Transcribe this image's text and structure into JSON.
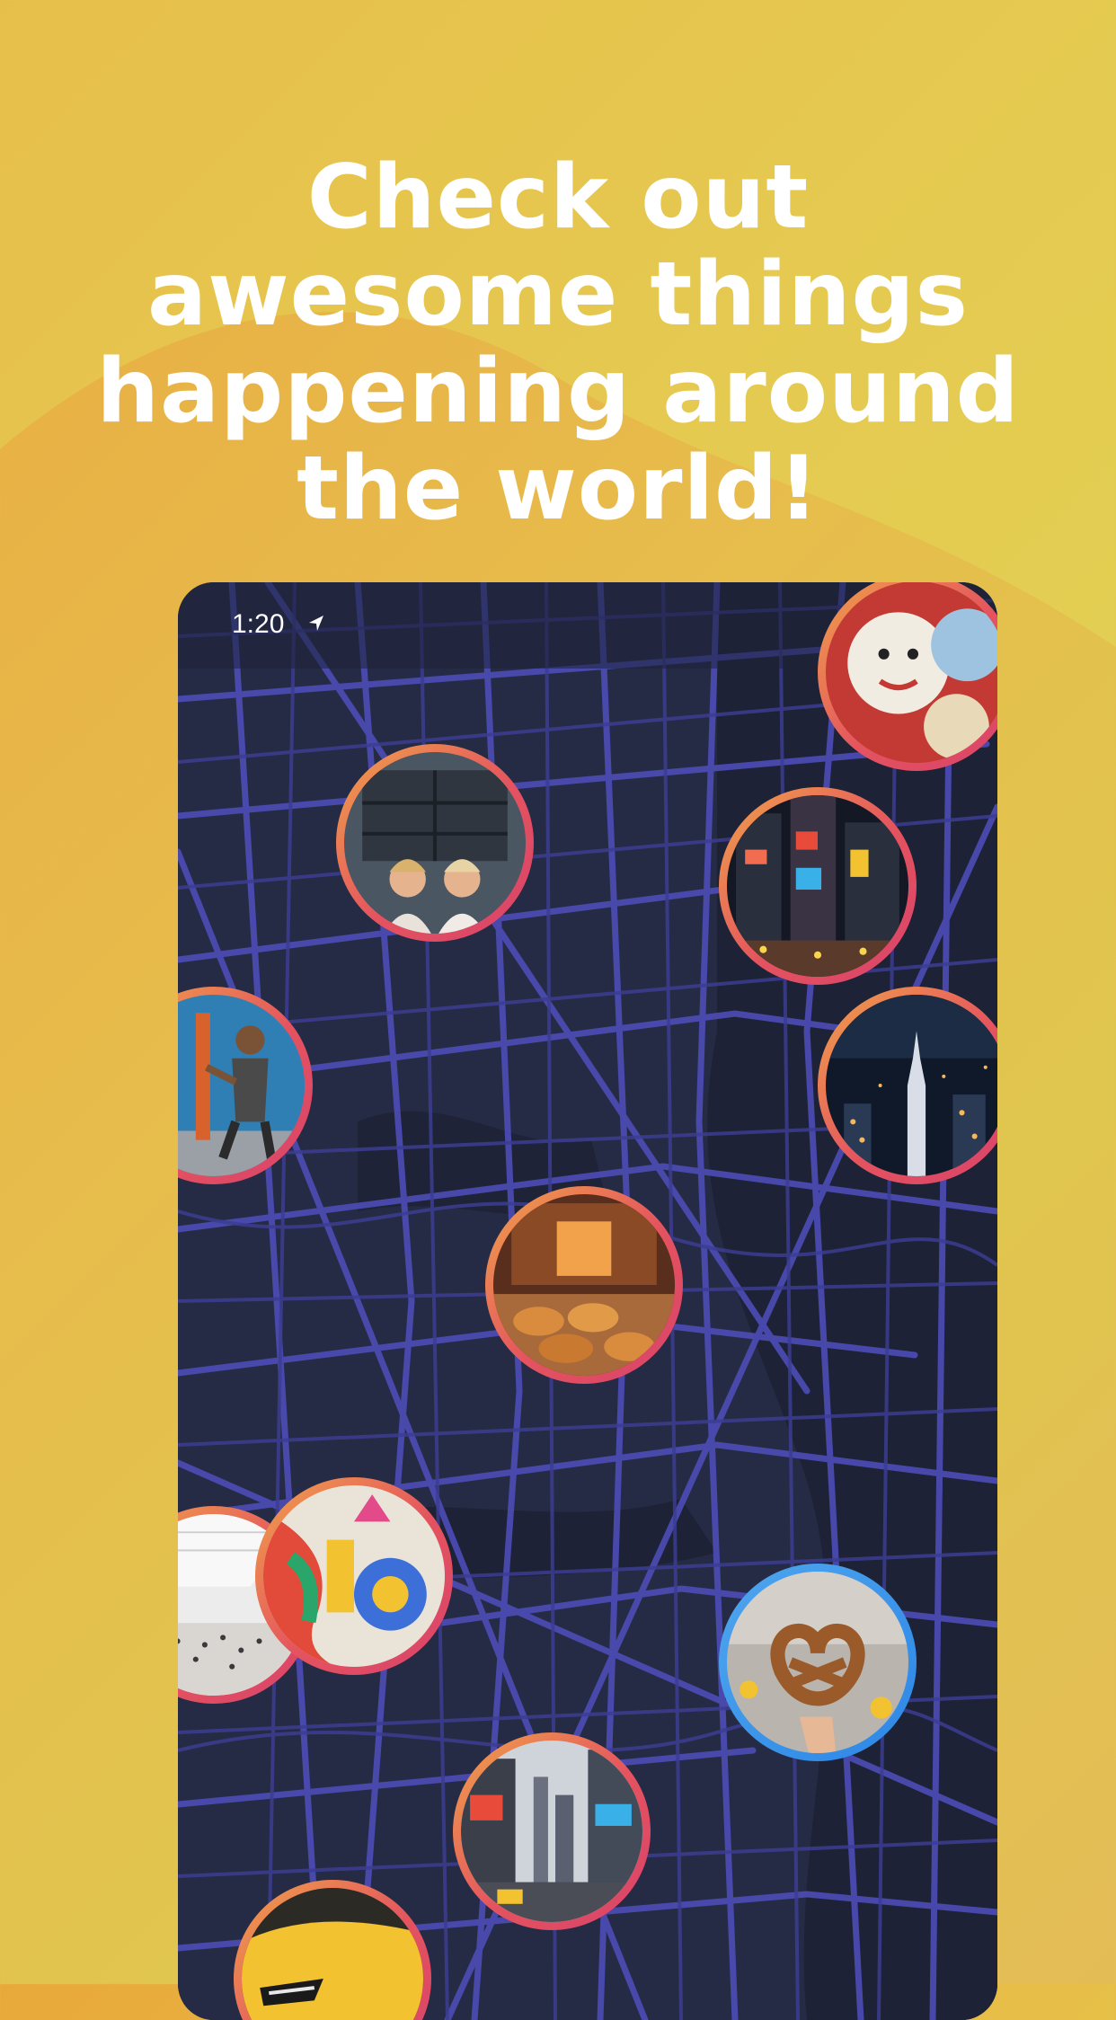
{
  "headline": {
    "lines": [
      "Check out",
      "awesome things",
      "happening around",
      "the world!"
    ]
  },
  "status_bar": {
    "time": "1:20"
  },
  "map": {
    "markers": [
      {
        "name": "cookies"
      },
      {
        "name": "friends"
      },
      {
        "name": "times-square-night"
      },
      {
        "name": "street-dancers"
      },
      {
        "name": "city-skyline-night"
      },
      {
        "name": "bakery"
      },
      {
        "name": "museum-hall"
      },
      {
        "name": "festival-dancer"
      },
      {
        "name": "pretzel"
      },
      {
        "name": "times-square-day"
      },
      {
        "name": "yellow-car"
      }
    ]
  },
  "colors": {
    "map_bg": "#262b45",
    "roads": "#4a4bb0",
    "ring_warm": "#e4535f",
    "ring_blue": "#3d96ea"
  }
}
